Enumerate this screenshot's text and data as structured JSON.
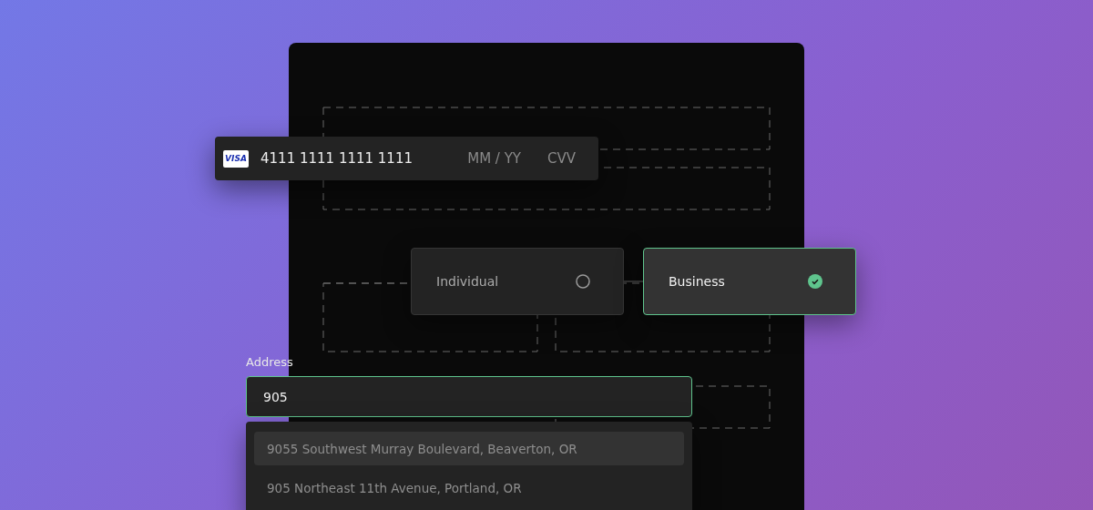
{
  "card": {
    "brand": "VISA",
    "number": "4111 1111 1111 1111",
    "expiry_placeholder": "MM / YY",
    "cvv_placeholder": "CVV"
  },
  "account_type": [
    {
      "label": "Individual",
      "selected": false
    },
    {
      "label": "Business",
      "selected": true
    }
  ],
  "address": {
    "label": "Address",
    "value": "905",
    "suggestions": [
      {
        "text": "9055 Southwest Murray Boulevard, Beaverton, OR",
        "selected": true
      },
      {
        "text": "905 Northeast 11th Avenue, Portland, OR",
        "selected": false
      }
    ]
  }
}
